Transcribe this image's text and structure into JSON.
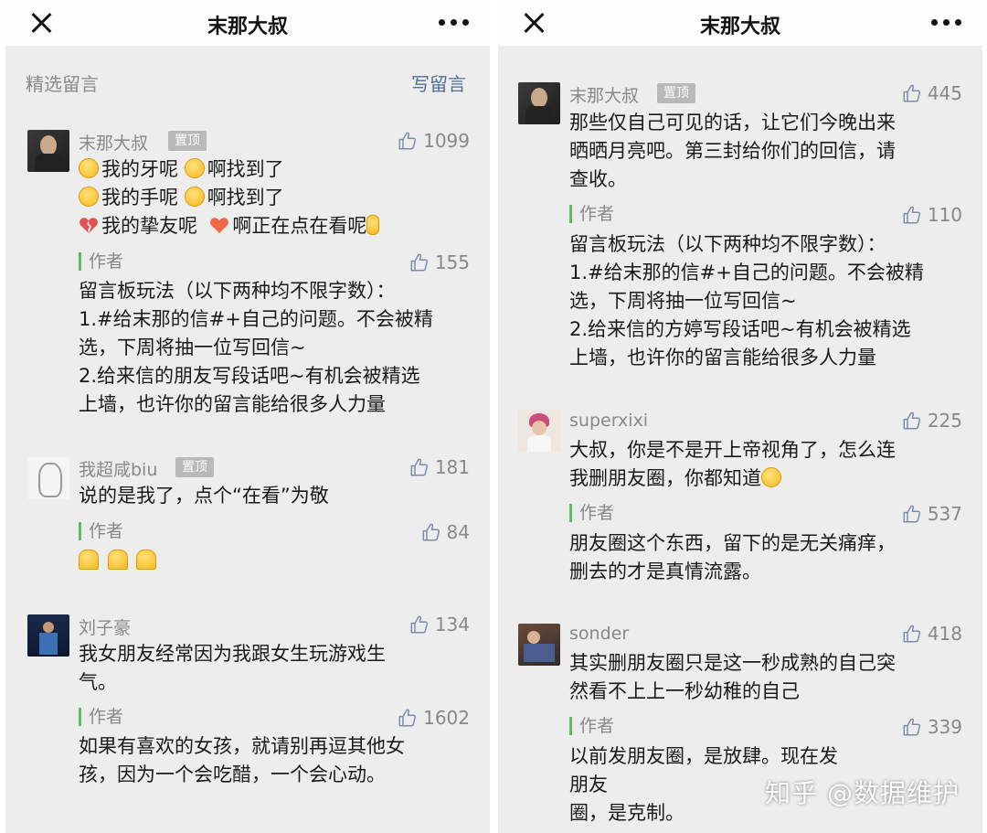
{
  "left": {
    "title": "末那大叔",
    "section_title": "精选留言",
    "write_label": "写留言",
    "comments": [
      {
        "nickname": "末那大叔",
        "pin": "置顶",
        "likes": "1099",
        "lines": [
          "我的牙呢",
          "啊找到了",
          "我的手呢",
          "啊找到了",
          "我的挚友呢",
          "啊正在点在看呢"
        ],
        "reply_label": "作者",
        "reply_likes": "155",
        "reply_lines": [
          "留言板玩法（以下两种均不限字数）：",
          "1.#给末那的信#+自己的问题。不会被精",
          "选，下周将抽一位写回信~",
          "2.给来信的朋友写段话吧~有机会被精选",
          "上墙，也许你的留言能给很多人力量"
        ]
      },
      {
        "nickname": "我超咸biu",
        "pin": "置顶",
        "likes": "181",
        "lines": [
          "说的是我了，点个“在看”为敬"
        ],
        "reply_label": "作者",
        "reply_likes": "84"
      },
      {
        "nickname": "刘子豪",
        "likes": "134",
        "lines": [
          "我女朋友经常因为我跟女生玩游戏生",
          "气。"
        ],
        "reply_label": "作者",
        "reply_likes": "1602",
        "reply_lines": [
          "如果有喜欢的女孩，就请别再逗其他女",
          "孩，因为一个会吃醋，一个会心动。"
        ]
      }
    ]
  },
  "right": {
    "title": "末那大叔",
    "comments": [
      {
        "nickname": "末那大叔",
        "pin": "置顶",
        "likes": "445",
        "lines": [
          "那些仅自己可见的话，让它们今晚出来",
          "晒晒月亮吧。第三封给你们的回信，请",
          "查收。"
        ],
        "reply_label": "作者",
        "reply_likes": "110",
        "reply_lines": [
          "留言板玩法（以下两种均不限字数）：",
          "1.#给末那的信#+自己的问题。不会被精",
          "选，下周将抽一位写回信~",
          "2.给来信的方婷写段话吧~有机会被精选",
          "上墙，也许你的留言能给很多人力量"
        ]
      },
      {
        "nickname": "superxixi",
        "likes": "225",
        "lines": [
          "大叔，你是不是开上帝视角了，怎么连",
          "我删朋友圈，你都知道"
        ],
        "reply_label": "作者",
        "reply_likes": "537",
        "reply_lines": [
          "朋友圈这个东西，留下的是无关痛痒，",
          "删去的才是真情流露。"
        ]
      },
      {
        "nickname": "sonder",
        "likes": "418",
        "lines": [
          "其实删朋友圈只是这一秒成熟的自己突",
          "然看不上上一秒幼稚的自己"
        ],
        "reply_label": "作者",
        "reply_likes": "339",
        "reply_lines": [
          "以前发朋友圈，是放肆。现在发朋友",
          "圈，是克制。"
        ]
      }
    ]
  },
  "watermark": "知乎 @数据维护",
  "icons": [
    "close-icon",
    "more-icon",
    "thumbs-up-icon",
    "emoji-icon",
    "heart-icon"
  ],
  "colors": {
    "link": "#576b95",
    "author_bar": "#5dbb63",
    "pin_bg": "#b9b9b9",
    "panel_bg": "#ededed"
  }
}
